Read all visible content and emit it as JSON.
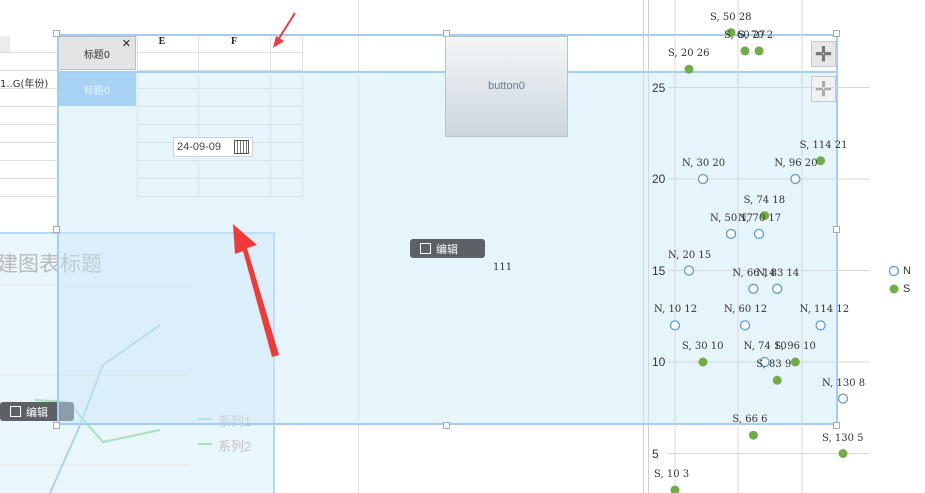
{
  "colors": {
    "selection_border": "#a5cdf3",
    "selection_fill": "#c8e7f7",
    "arrow": "#f03a3a",
    "series_n": "#5b9bd5",
    "series_s": "#70ad47"
  },
  "spreadsheet": {
    "col_headers": [
      "E",
      "F"
    ],
    "cell_year_label": "1..G(年份)"
  },
  "tabs": [
    {
      "label": "标题0",
      "close": "✕"
    },
    {
      "label": "标题0",
      "close": ""
    }
  ],
  "date_widget": {
    "value": "24-09-09",
    "icon": "calendar-icon"
  },
  "button0": {
    "label": "button0"
  },
  "center_edit": {
    "label": "编辑",
    "icon": "edit-icon"
  },
  "center_text": "111",
  "left_chart": {
    "title": "建图表标题",
    "edit_label": "编辑",
    "legend": [
      "系列1",
      "系列2"
    ]
  },
  "toolbar_icons": [
    "plus-icon",
    "plus-icon"
  ],
  "chart_data": {
    "type": "scatter",
    "title": "",
    "ylim": [
      3,
      28
    ],
    "yticks": [
      5,
      10,
      15,
      20,
      25
    ],
    "legend": [
      "N",
      "S"
    ],
    "series": [
      {
        "name": "N",
        "points": [
          {
            "x": 30,
            "y": 20,
            "label": "N, 30  20"
          },
          {
            "x": 96,
            "y": 20,
            "label": "N, 96  20"
          },
          {
            "x": 50,
            "y": 17,
            "label": "N, 50  17"
          },
          {
            "x": 70,
            "y": 17,
            "label": "N, 70  17"
          },
          {
            "x": 20,
            "y": 15,
            "label": "N, 20  15"
          },
          {
            "x": 66,
            "y": 14,
            "label": "N, 66  14"
          },
          {
            "x": 83,
            "y": 14,
            "label": "N, 83  14"
          },
          {
            "x": 10,
            "y": 12,
            "label": "N, 10  12"
          },
          {
            "x": 60,
            "y": 12,
            "label": "N, 60  12"
          },
          {
            "x": 114,
            "y": 12,
            "label": "N, 114 12"
          },
          {
            "x": 74,
            "y": 10,
            "label": "N, 74  10"
          },
          {
            "x": 130,
            "y": 8,
            "label": "N, 130  8"
          }
        ]
      },
      {
        "name": "S",
        "points": [
          {
            "x": 50,
            "y": 28,
            "label": "S, 50  28"
          },
          {
            "x": 60,
            "y": 27,
            "label": "S, 60  27"
          },
          {
            "x": 70,
            "y": 27,
            "label": "S, 70  2"
          },
          {
            "x": 20,
            "y": 26,
            "label": "S, 20  26"
          },
          {
            "x": 114,
            "y": 21,
            "label": "S, 114  21"
          },
          {
            "x": 74,
            "y": 18,
            "label": "S, 74  18"
          },
          {
            "x": 30,
            "y": 10,
            "label": "S, 30  10"
          },
          {
            "x": 96,
            "y": 10,
            "label": "S, 96  10"
          },
          {
            "x": 83,
            "y": 9,
            "label": "S, 83  9"
          },
          {
            "x": 66,
            "y": 6,
            "label": "S, 66  6"
          },
          {
            "x": 130,
            "y": 5,
            "label": "S, 130  5"
          },
          {
            "x": 10,
            "y": 3,
            "label": "S, 10  3"
          }
        ]
      }
    ]
  }
}
